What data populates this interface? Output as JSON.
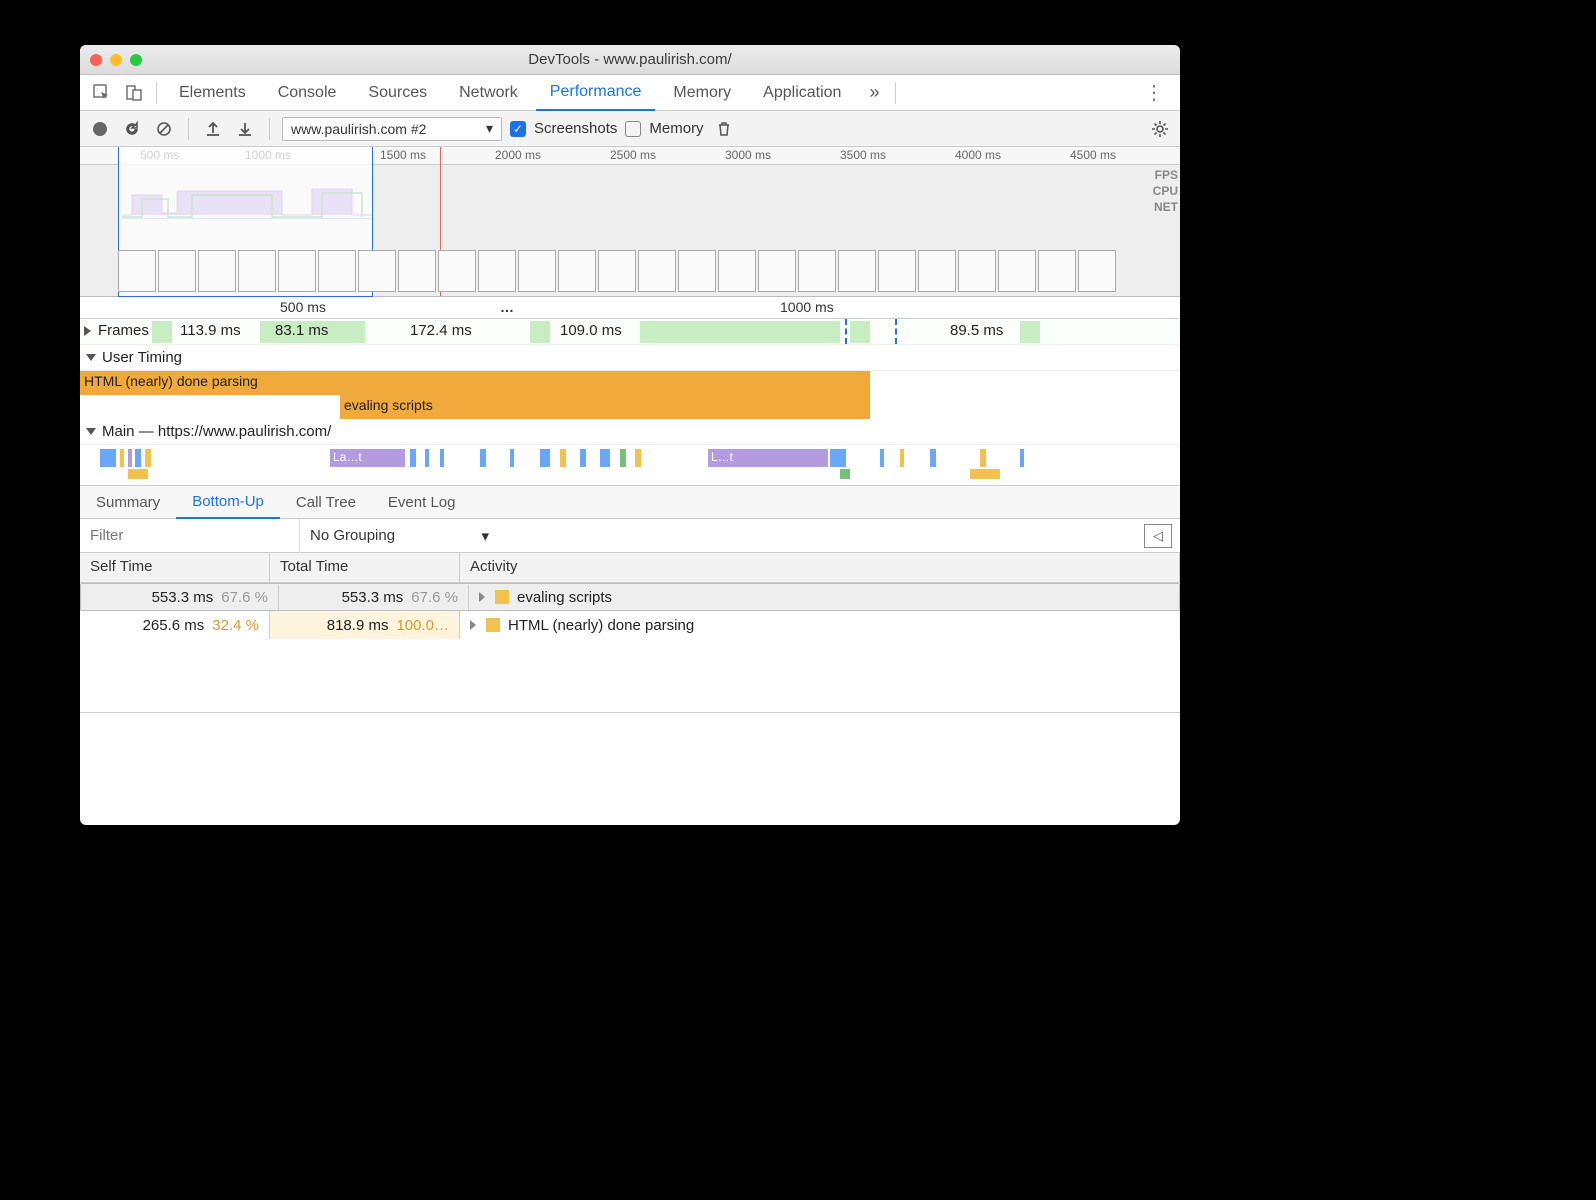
{
  "window": {
    "title": "DevTools - www.paulirish.com/"
  },
  "tabs": {
    "items": [
      "Elements",
      "Console",
      "Sources",
      "Network",
      "Performance",
      "Memory",
      "Application"
    ],
    "active": "Performance",
    "more": "»"
  },
  "toolbar": {
    "recording_select": "www.paulirish.com #2",
    "screenshots_label": "Screenshots",
    "screenshots_checked": true,
    "memory_label": "Memory",
    "memory_checked": false
  },
  "overview": {
    "ticks": [
      "500 ms",
      "1000 ms",
      "1500 ms",
      "2000 ms",
      "2500 ms",
      "3000 ms",
      "3500 ms",
      "4000 ms",
      "4500 ms"
    ],
    "side_labels": [
      "FPS",
      "CPU",
      "NET"
    ]
  },
  "ruler2": {
    "ticks": [
      "500 ms",
      "1000 ms"
    ],
    "ellipsis": "…"
  },
  "frames": {
    "label": "Frames",
    "values": [
      "113.9 ms",
      "83.1 ms",
      "172.4 ms",
      "109.0 ms",
      "89.5 ms"
    ]
  },
  "user_timing": {
    "label": "User Timing",
    "bars": [
      {
        "label": "HTML (nearly) done parsing"
      },
      {
        "label": "evaling scripts"
      }
    ]
  },
  "main": {
    "label": "Main — https://www.paulirish.com/",
    "slices": [
      "La…t",
      "L…t"
    ]
  },
  "bottom_tabs": {
    "items": [
      "Summary",
      "Bottom-Up",
      "Call Tree",
      "Event Log"
    ],
    "active": "Bottom-Up"
  },
  "filter": {
    "placeholder": "Filter",
    "grouping": "No Grouping"
  },
  "table": {
    "headers": [
      "Self Time",
      "Total Time",
      "Activity"
    ],
    "rows": [
      {
        "self_ms": "553.3 ms",
        "self_pct": "67.6 %",
        "total_ms": "553.3 ms",
        "total_pct": "67.6 %",
        "activity": "evaling scripts",
        "selected": true
      },
      {
        "self_ms": "265.6 ms",
        "self_pct": "32.4 %",
        "total_ms": "818.9 ms",
        "total_pct": "100.0…",
        "activity": "HTML (nearly) done parsing",
        "selected": false
      }
    ]
  }
}
